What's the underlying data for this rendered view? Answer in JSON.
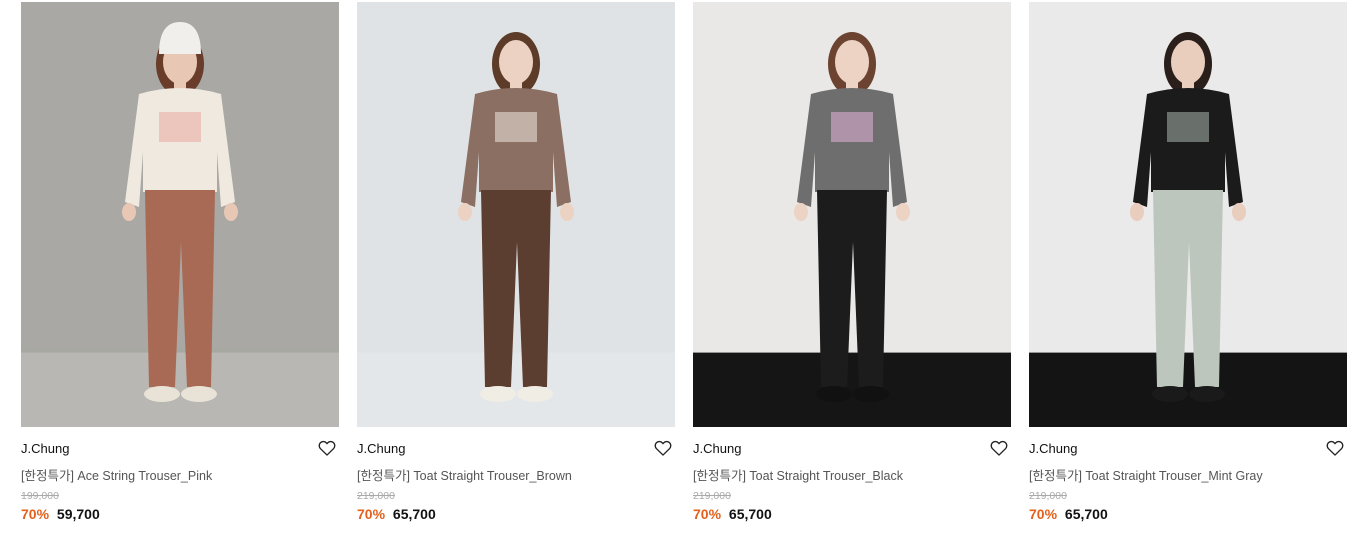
{
  "products": [
    {
      "brand": "J.Chung",
      "name": "[한정특가] Ace String Trouser_Pink",
      "original_price": "199,000",
      "discount": "70%",
      "sale_price": "59,700",
      "wishlist_icon": "heart-outline-icon",
      "photo": {
        "bg": "#a9a8a4",
        "floor": "#b9b7b3",
        "top": "#efe9e0",
        "bottom": "#a86a55",
        "skin": "#e8c8b4",
        "hair": "#6a3c2a",
        "hat": "#f1efeb",
        "shoe": "#e9e2d6",
        "accent": "#e9a8a0"
      }
    },
    {
      "brand": "J.Chung",
      "name": "[한정특가] Toat Straight Trouser_Brown",
      "original_price": "219,000",
      "discount": "70%",
      "sale_price": "65,700",
      "wishlist_icon": "heart-outline-icon",
      "photo": {
        "bg": "#dfe3e6",
        "floor": "#e4e7ea",
        "top": "#8a6f62",
        "bottom": "#5c3e30",
        "skin": "#ecd2c2",
        "hair": "#5d3b29",
        "hat": "",
        "shoe": "#f0ede4",
        "accent": "#efe7df"
      }
    },
    {
      "brand": "J.Chung",
      "name": "[한정특가] Toat Straight Trouser_Black",
      "original_price": "219,000",
      "discount": "70%",
      "sale_price": "65,700",
      "wishlist_icon": "heart-outline-icon",
      "photo": {
        "bg": "#e9e8e6",
        "floor": "#151515",
        "top": "#6e6e6e",
        "bottom": "#1c1c1c",
        "skin": "#ecd3c3",
        "hair": "#6b4330",
        "hat": "",
        "shoe": "#111111",
        "accent": "#e5b3d9"
      }
    },
    {
      "brand": "J.Chung",
      "name": "[한정특가] Toat Straight Trouser_Mint Gray",
      "original_price": "219,000",
      "discount": "70%",
      "sale_price": "65,700",
      "wishlist_icon": "heart-outline-icon",
      "photo": {
        "bg": "#ebeaea",
        "floor": "#141414",
        "top": "#1b1b1b",
        "bottom": "#bcc6bd",
        "skin": "#e9cdbd",
        "hair": "#2a1f1a",
        "hat": "",
        "shoe": "#1a1a1a",
        "accent": "#a9b5ab"
      }
    }
  ],
  "colors": {
    "discount": "#e2611d",
    "price": "#111111",
    "original_price": "#aaaaaa"
  }
}
